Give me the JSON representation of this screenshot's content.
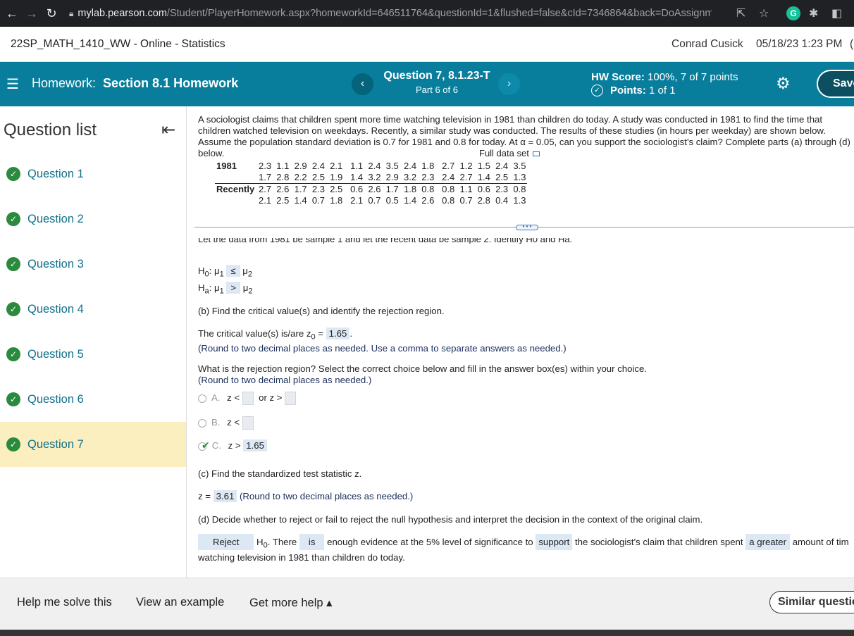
{
  "browser": {
    "url_host": "mylab.pearson.com",
    "url_path": "/Student/PlayerHomework.aspx?homeworkId=646511764&questionId=1&flushed=false&cId=7346864&back=DoAssignme..."
  },
  "course": {
    "title": "22SP_MATH_1410_WW - Online - Statistics",
    "user": "Conrad Cusick",
    "datetime": "05/18/23 1:23 PM"
  },
  "hwbar": {
    "hw_prefix": "Homework:",
    "hw_name": "Section 8.1 Homework",
    "question_title": "Question 7, 8.1.23-T",
    "part": "Part 6 of 6",
    "score_label": "HW Score:",
    "score_value": "100%, 7 of 7 points",
    "points_label": "Points:",
    "points_value": "1 of 1",
    "save_label": "Save"
  },
  "sidebar": {
    "title": "Question list",
    "questions": [
      "Question 1",
      "Question 2",
      "Question 3",
      "Question 4",
      "Question 5",
      "Question 6",
      "Question 7"
    ]
  },
  "problem": {
    "text": "A sociologist claims that children spent more time watching television in 1981 than children do today. A study was conducted in 1981 to find the time that children watched television on weekdays. Recently, a similar study was conducted. The results of these studies (in hours per weekday) are shown below. Assume the population standard deviation is 0.7 for 1981 and 0.8 for today. At α = 0.05, can you support the sociologist's claim? Complete parts (a) through (d) below.",
    "full_data_set": "Full data set",
    "table": {
      "row1_label": "1981",
      "row1_line1": "2.3  1.1  2.9  2.4  2.1   1.1  2.4  3.5  2.4  1.8   2.7  1.2  1.5  2.4  3.5",
      "row1_line2": "1.7  2.8  2.2  2.5  1.9   1.4  3.2  2.9  3.2  2.3   2.4  2.7  1.4  2.5  1.3",
      "row2_label": "Recently",
      "row2_line1": "2.7  2.6  1.7  2.3  2.5   0.6  2.6  1.7  1.8  0.8   0.8  1.1  0.6  2.3  0.8",
      "row2_line2": "2.1  2.5  1.4  0.7  1.8   2.1  0.7  0.5  1.4  2.6   0.8  0.7  2.8  0.4  1.3"
    }
  },
  "part_a": {
    "cut_text": "Let the data from 1981 be sample 1 and let the recent data be sample 2. Identify H0 and Ha.",
    "h0_sym": "≤",
    "ha_sym": ">"
  },
  "part_b": {
    "prompt": "(b) Find the critical value(s) and identify the rejection region.",
    "critical_prefix": "The critical value(s) is/are z",
    "critical_value": "1.65",
    "critical_hint": "(Round to two decimal places as needed. Use a comma to separate answers as needed.)",
    "region_prompt": "What is the rejection region? Select the correct choice below and fill in the answer box(es) within your choice.",
    "region_hint": "(Round to two decimal places as needed.)",
    "option_a_letter": "A.",
    "option_a_text1": "z <",
    "option_a_text2": "or z >",
    "option_b_letter": "B.",
    "option_b_text": "z <",
    "option_c_letter": "C.",
    "option_c_text": "z >",
    "option_c_value": "1.65"
  },
  "part_c": {
    "prompt": "(c) Find the standardized test statistic z.",
    "z_prefix": "z =",
    "z_value": "3.61",
    "z_hint": "(Round to two decimal places as needed.)"
  },
  "part_d": {
    "prompt": "(d) Decide whether to reject or fail to reject the null hypothesis and interpret the decision in the context of the original claim.",
    "decision": "Reject",
    "text1": ". There",
    "is_value": "is",
    "text2": "enough evidence at the 5% level of significance to",
    "support_value": "support",
    "text3": "the sociologist's claim that children spent",
    "greater_value": "a greater",
    "text4": "amount of tim",
    "line2": "watching television in 1981 than children do today."
  },
  "footer": {
    "help": "Help me solve this",
    "example": "View an example",
    "more_help": "Get more help ▴",
    "similar": "Similar questio"
  }
}
